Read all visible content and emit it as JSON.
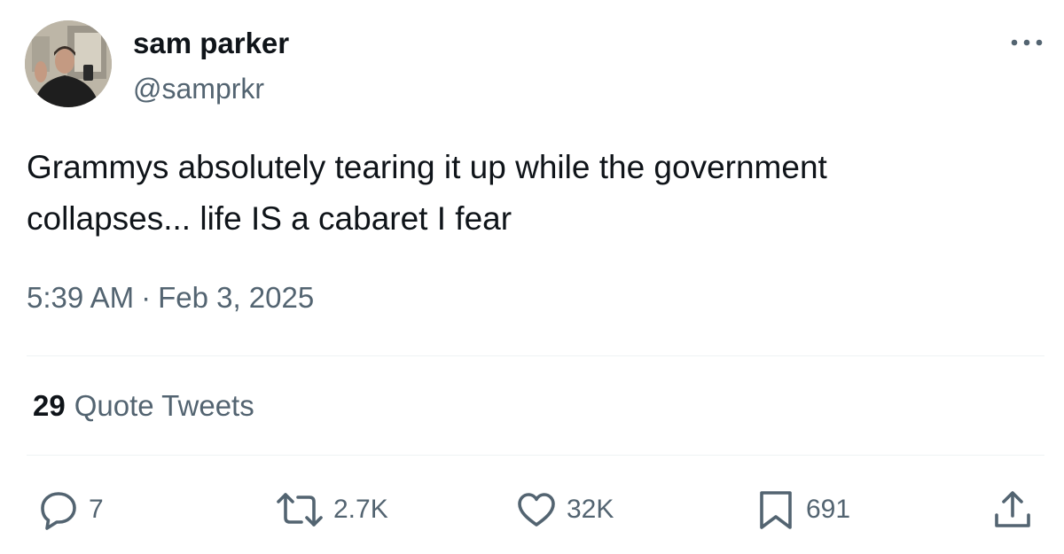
{
  "author": {
    "name": "sam parker",
    "handle": "@samprkr"
  },
  "tweet": {
    "text_lines": [
      "Grammys absolutely tearing it up while the government",
      "collapses... life IS a cabaret I fear"
    ],
    "time": "5:39 AM",
    "separator": "·",
    "date": "Feb 3, 2025"
  },
  "quote_tweets": {
    "count": "29",
    "label": "Quote Tweets"
  },
  "actions": {
    "replies": "7",
    "retweets": "2.7K",
    "likes": "32K",
    "bookmarks": "691"
  },
  "icons": {
    "more": "more-horizontal-icon",
    "reply": "speech-bubble-icon",
    "retweet": "retweet-arrows-icon",
    "like": "heart-icon",
    "bookmark": "bookmark-icon",
    "share": "share-upload-icon"
  },
  "colors": {
    "text_primary": "#0f1419",
    "text_secondary": "#536471",
    "divider": "#eff3f4"
  }
}
